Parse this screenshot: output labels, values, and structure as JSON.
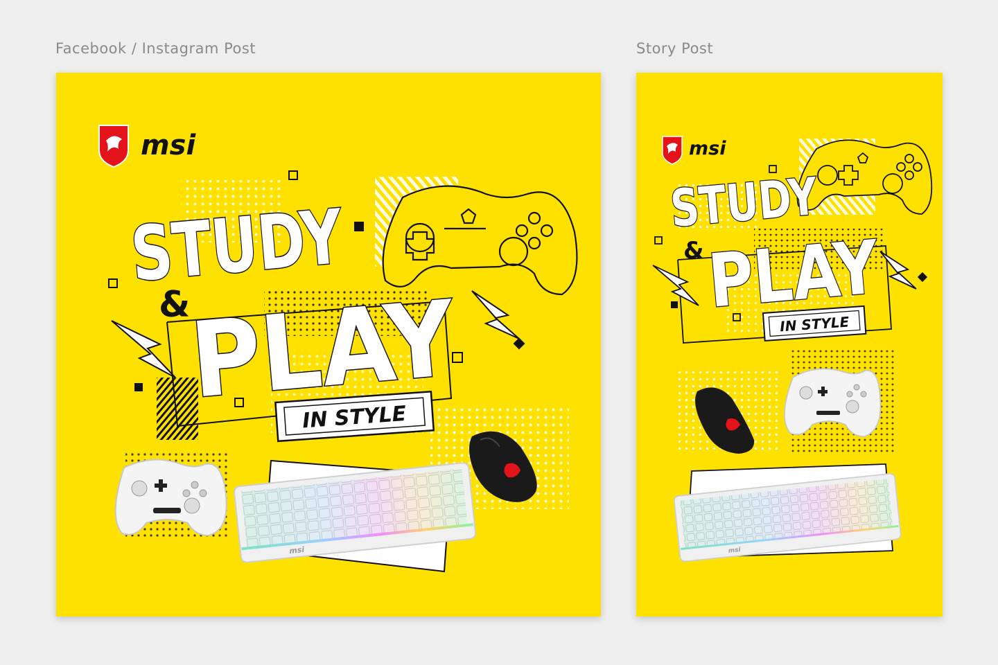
{
  "labels": {
    "post": "Facebook / Instagram Post",
    "story": "Story Post"
  },
  "brand": {
    "name": "msi",
    "accent_color": "#e3131b"
  },
  "headline": {
    "line1": "STUDY",
    "amp": "&",
    "line2": "PLAY",
    "tagline": "IN STYLE"
  },
  "colors": {
    "background": "#ffe100",
    "ink": "#111111",
    "page": "#eeeeee"
  },
  "products": [
    "gamepad",
    "keyboard",
    "mouse"
  ],
  "icons": [
    "msi-dragon-shield-icon",
    "controller-outline-icon",
    "lightning-icon",
    "halftone-dots"
  ]
}
